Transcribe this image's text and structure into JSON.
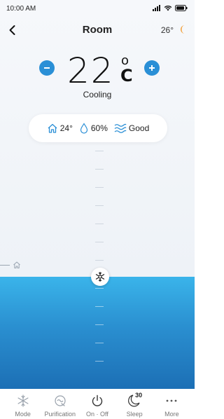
{
  "status_bar": {
    "time": "10:00 AM"
  },
  "header": {
    "title": "Room",
    "outdoor_temp": "26°"
  },
  "thermostat": {
    "setpoint": "22",
    "degree_symbol": "o",
    "unit": "C",
    "mode": "Cooling"
  },
  "environment": {
    "indoor_temp": "24°",
    "humidity": "60%",
    "air_quality": "Good"
  },
  "bottom_nav": {
    "items": [
      {
        "label": "Mode",
        "icon": "snowflake-icon"
      },
      {
        "label": "Purification",
        "icon": "purification-icon"
      },
      {
        "label": "On · Off",
        "icon": "power-icon"
      },
      {
        "label": "Sleep",
        "icon": "sleep-timer-icon",
        "badge": "30"
      },
      {
        "label": "More",
        "icon": "more-dots-icon"
      }
    ]
  },
  "colors": {
    "accent": "#2a8fd6",
    "water_top": "#3ab4ea",
    "water_bottom": "#1c6fb5",
    "icon_blue": "#2a8fd6",
    "sun": "#f2a03a"
  }
}
